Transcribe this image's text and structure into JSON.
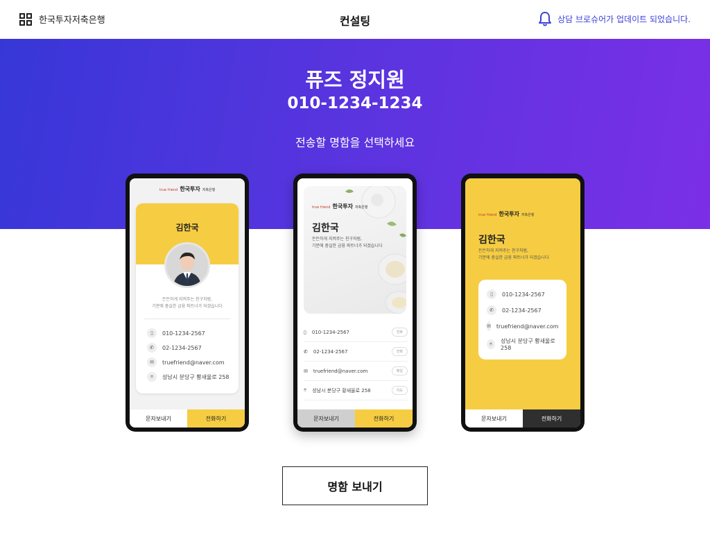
{
  "header": {
    "brand": "한국투자저축은행",
    "title": "컨설팅",
    "notice": "상담 브로슈어가 업데이트 되었습니다."
  },
  "hero": {
    "name": "퓨즈 정지원",
    "phone": "010-1234-1234",
    "instruction": "전송할 명함을 선택하세요"
  },
  "cards": {
    "logo": {
      "brand": "한국투자",
      "tagmark": "true friend",
      "sub": "저축은행"
    },
    "person": "김한국",
    "tagline1": "든든하게 지켜주는 친구처럼,",
    "tagline2": "기분에 충실한 금융 파트너가 되겠습니다",
    "mobile": "010-1234-2567",
    "tel": "02-1234-2567",
    "email": "truefriend@naver.com",
    "address": "성남시 분당구 황새울로 258",
    "btn_sms": "문자보내기",
    "btn_call": "전화하기",
    "pill_call": "전화",
    "pill_mail": "메일",
    "pill_map": "지도"
  },
  "cta": {
    "label": "명함 보내기"
  },
  "colors": {
    "accent": "#3b3fd8",
    "yellow": "#f6cd42",
    "dark": "#111111"
  }
}
